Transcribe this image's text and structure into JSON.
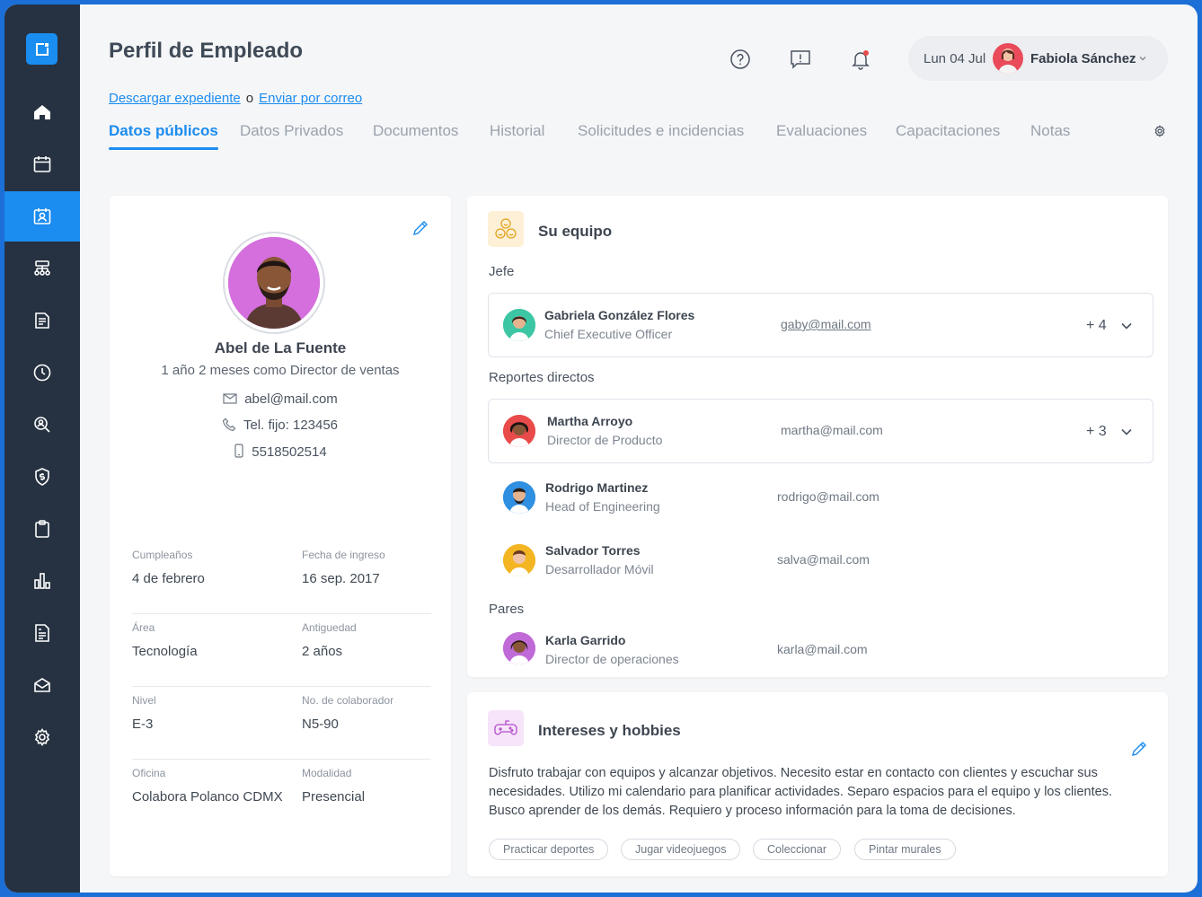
{
  "colors": {
    "accent": "#1b8cf0",
    "sidebar": "#263241",
    "frame": "#1b6fd6"
  },
  "header": {
    "title": "Perfil de Empleado",
    "icons": [
      "help-icon",
      "feedback-icon",
      "bell-icon"
    ],
    "user": {
      "date": "Lun 04 Jul",
      "name": "Fabiola Sánchez"
    }
  },
  "links": {
    "download": "Descargar expediente",
    "separator": "o",
    "email": "Enviar por correo"
  },
  "tabs": [
    {
      "label": "Datos públicos"
    },
    {
      "label": "Datos Privados"
    },
    {
      "label": "Documentos"
    },
    {
      "label": "Historial"
    },
    {
      "label": "Solicitudes e incidencias"
    },
    {
      "label": "Evaluaciones"
    },
    {
      "label": "Capacitaciones"
    },
    {
      "label": "Notas"
    }
  ],
  "sidebar": {
    "items": [
      "home-icon",
      "calendar-icon",
      "profile-card-icon",
      "org-chart-icon",
      "document-list-icon",
      "clock-icon",
      "search-person-icon",
      "shield-dollar-icon",
      "clipboard-icon",
      "bar-chart-icon",
      "report-icon",
      "inbox-icon",
      "gear-icon"
    ],
    "active_index": 2
  },
  "profile": {
    "name": "Abel de La Fuente",
    "role": "1 año 2 meses como Director de ventas",
    "email": "abel@mail.com",
    "phone": "Tel. fijo: 123456",
    "mobile": "5518502514",
    "fields": [
      [
        {
          "label": "Cumpleaños",
          "value": "4 de febrero"
        },
        {
          "label": "Fecha de ingreso",
          "value": "16 sep. 2017"
        }
      ],
      [
        {
          "label": "Área",
          "value": "Tecnología"
        },
        {
          "label": "Antiguedad",
          "value": "2 años"
        }
      ],
      [
        {
          "label": "Nivel",
          "value": "E-3"
        },
        {
          "label": "No. de colaborador",
          "value": "N5-90"
        }
      ],
      [
        {
          "label": "Oficina",
          "value": "Colabora Polanco CDMX"
        },
        {
          "label": "Modalidad",
          "value": "Presencial"
        }
      ]
    ]
  },
  "team": {
    "title": "Su equipo",
    "boss_label": "Jefe",
    "boss": {
      "name": "Gabriela González Flores",
      "title": "Chief Executive Officer",
      "email": "gaby@mail.com",
      "count": "+ 4"
    },
    "reports_label": "Reportes directos",
    "reports": [
      {
        "name": "Martha Arroyo",
        "title": "Director de Producto",
        "email": "martha@mail.com",
        "count": "+ 3"
      },
      {
        "name": "Rodrigo Martinez",
        "title": "Head of Engineering",
        "email": "rodrigo@mail.com"
      },
      {
        "name": "Salvador Torres",
        "title": "Desarrollador Móvil",
        "email": "salva@mail.com"
      }
    ],
    "peers_label": "Pares",
    "peers": [
      {
        "name": "Karla Garrido",
        "title": "Director de operaciones",
        "email": "karla@mail.com"
      }
    ]
  },
  "hobbies": {
    "title": "Intereses y hobbies",
    "text": "Disfruto trabajar con equipos y alcanzar objetivos. Necesito estar en contacto con clientes y escuchar sus necesidades. Utilizo mi calendario para planificar actividades. Separo espacios para el equipo y los clientes. Busco aprender de los demás. Requiero y proceso información para la toma de decisiones.",
    "tags": [
      "Practicar deportes",
      "Jugar videojuegos",
      "Coleccionar",
      "Pintar murales"
    ]
  }
}
